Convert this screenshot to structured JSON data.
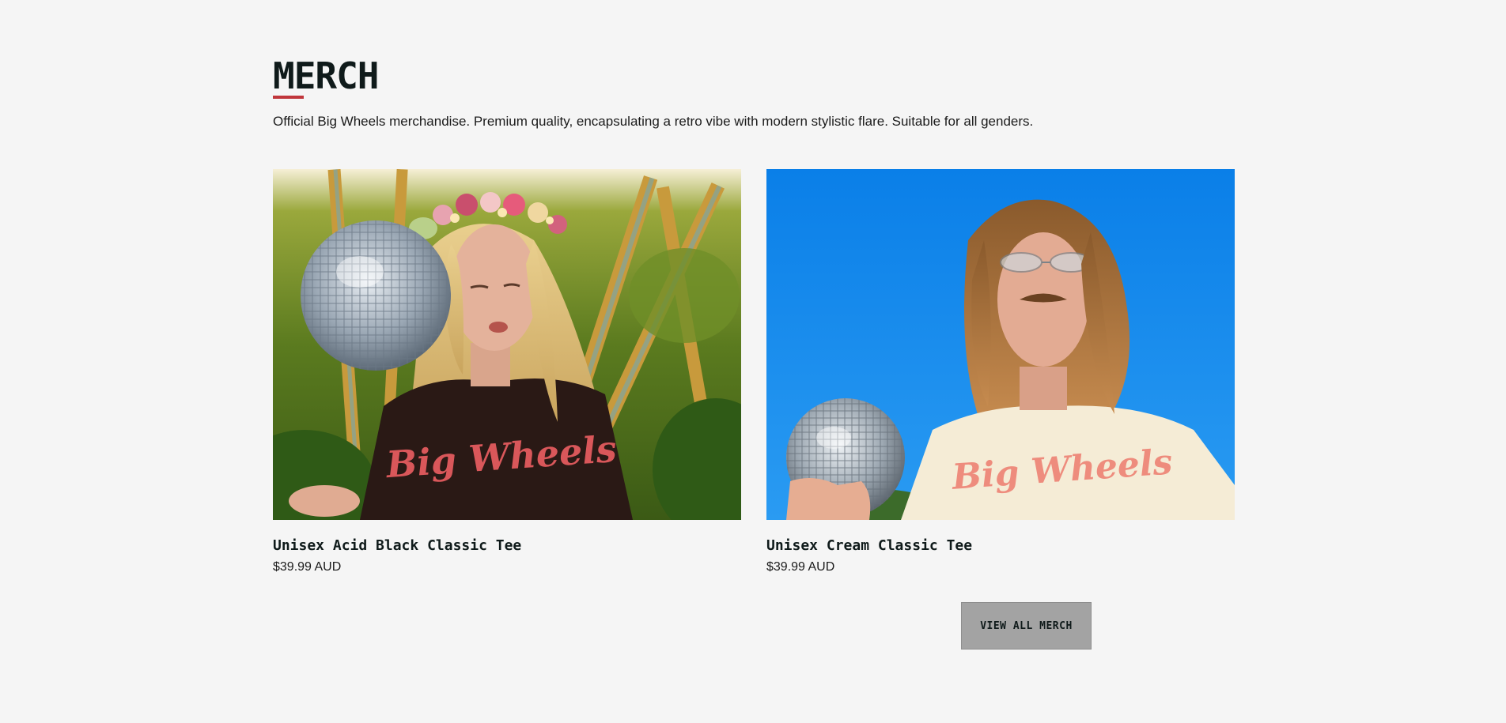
{
  "merch": {
    "title": "MERCH",
    "description": "Official Big Wheels merchandise. Premium quality, encapsulating a retro vibe with modern stylistic flare. Suitable for all genders.",
    "accent_color": "#c0363b",
    "products": [
      {
        "name": "Unisex Acid Black Classic Tee",
        "price": "$39.99 AUD",
        "shirt_print": "Big Wheels",
        "image_icon": "product-photo-black-tee"
      },
      {
        "name": "Unisex Cream Classic Tee",
        "price": "$39.99 AUD",
        "shirt_print": "Big Wheels",
        "image_icon": "product-photo-cream-tee"
      }
    ],
    "view_all_label": "VIEW ALL MERCH"
  }
}
